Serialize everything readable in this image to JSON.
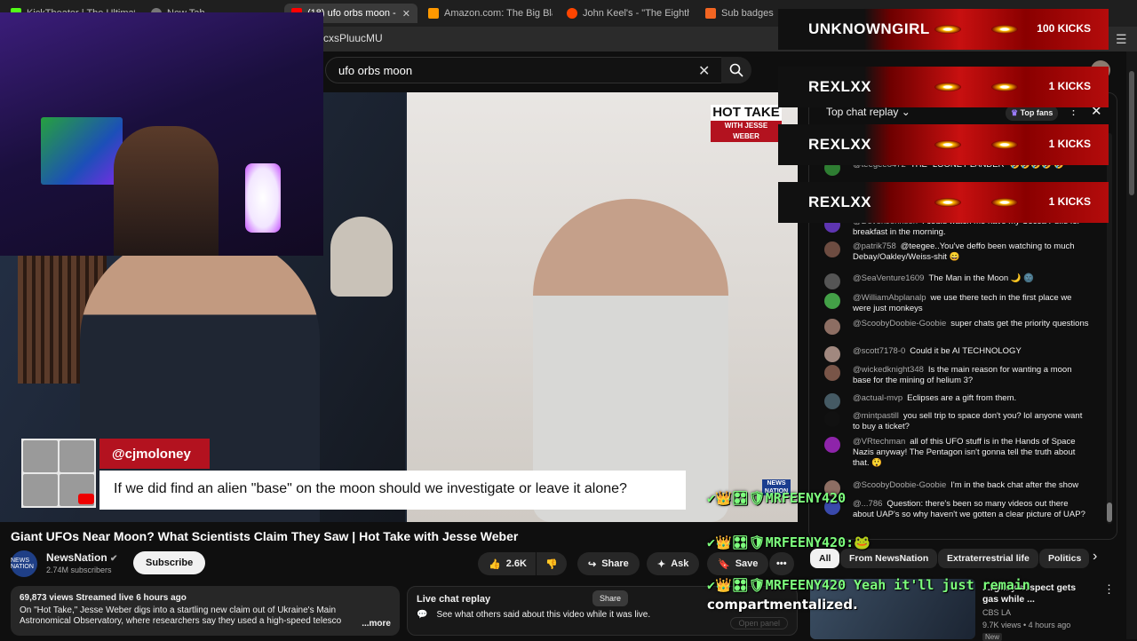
{
  "browser": {
    "tabs": [
      {
        "label": "KickTheater | The Ultimate Ki",
        "color": "#53fc18"
      },
      {
        "label": "New Tab",
        "color": "#888888"
      },
      {
        "label": "(18) ufo orbs moon -",
        "color": "#ff0000"
      },
      {
        "label": "Amazon.com: The Big Blacko",
        "color": "#ff9900"
      },
      {
        "label": "John Keel's - \"The Eighth Tow",
        "color": "#ff4500"
      },
      {
        "label": "Sub badges - El",
        "color": "#f26522"
      }
    ],
    "url_fragment": "cxsPluucMU"
  },
  "search": {
    "query": "ufo orbs moon"
  },
  "video": {
    "hot_take": "HOT TAKE",
    "hot_take_sub": "WITH JESSE WEBER",
    "handle": "@cjmoloney",
    "question": "If we did find an alien \"base\" on the moon should we investigate or leave it alone?",
    "news_logo": "NEWS NATION",
    "title": "Giant UFOs Near Moon? What Scientists Claim They Saw | Hot Take with Jesse Weber",
    "channel": "NewsNation",
    "channel_logo": "NEWS NATION",
    "subscribers": "2.74M subscribers",
    "subscribe_label": "Subscribe",
    "likes": "2.6K",
    "share_label": "Share",
    "ask_label": "Ask",
    "save_label": "Save"
  },
  "description": {
    "meta": "69,873 views  Streamed live 6 hours ago",
    "text": "On \"Hot Take,\" Jesse Weber digs into a startling new claim out of Ukraine's Main Astronomical Observatory, where researchers say they used a high-speed telesco",
    "more": "...more"
  },
  "live_replay": {
    "title": "Live chat replay",
    "share": "Share",
    "body": "See what others said about this video while it was live.",
    "open_panel": "Open panel"
  },
  "chat": {
    "header": "Top chat replay",
    "top_fans": "Top fans",
    "messages": [
      {
        "author": "@teegee8472",
        "text": "THE \"LOONEY LANDER\" 🤣🤣🤣🤣 🤣",
        "color": "#2e7d32"
      },
      {
        "author": "@DevenJohnson",
        "text": "I could watch me have my Cocoa Puffs for breakfast in the morning.",
        "color": "#5e35b1"
      },
      {
        "author": "@patrik758",
        "text": "@teegee..You've deffo been watching to much Debay/Oakley/Weiss-shit 😄",
        "color": "#6d4c41"
      },
      {
        "author": "@SeaVenture1609",
        "text": "The Man in the Moon 🌙 🌚",
        "color": "#555555"
      },
      {
        "author": "@WilliamAbplanalp",
        "text": "we use there tech in the first place we were just monkeys",
        "color": "#43a047"
      },
      {
        "author": "@ScoobyDoobie-Goobie",
        "text": "super chats get the priority questions",
        "color": "#8d6e63"
      },
      {
        "author": "@scott7178-0",
        "text": "Could it be AI TECHNOLOGY",
        "color": "#a1887f"
      },
      {
        "author": "@wickedknight348",
        "text": "Is the main reason for wanting a moon base for the mining of helium 3?",
        "color": "#795548"
      },
      {
        "author": "@actual-mvp",
        "text": "Eclipses are a gift from them.",
        "color": "#455a64"
      },
      {
        "author": "@mintpastill",
        "text": "you sell trip to space don't you? lol anyone want to buy a ticket?",
        "color": "#111111"
      },
      {
        "author": "@VRtechman",
        "text": "all of this UFO stuff is in the Hands of Space Nazis anyway! The Pentagon isn't gonna tell the truth about that. 😲",
        "color": "#8e24aa"
      },
      {
        "author": "@ScoobyDoobie-Goobie",
        "text": "I'm in the back chat after the show",
        "color": "#8d6e63"
      },
      {
        "author": "@...786",
        "text": "Question: there's been so many videos out there about UAP's so why haven't we gotten a clear picture of UAP?",
        "color": "#3949ab"
      }
    ]
  },
  "kicks": [
    {
      "name": "UNKNOWNGIRL",
      "amount": "100 KICKS"
    },
    {
      "name": "REXLXX",
      "amount": "1 KICKS"
    },
    {
      "name": "REXLXX",
      "amount": "1 KICKS"
    },
    {
      "name": "REXLXX",
      "amount": "1 KICKS"
    }
  ],
  "chips": [
    "All",
    "From NewsNation",
    "Extraterrestrial life",
    "Politics"
  ],
  "recommendation": {
    "title": "...rglary suspect gets gas while ...",
    "channel": "CBS LA",
    "meta": "9.7K views • 4 hours ago",
    "badge": "New"
  },
  "overlay": {
    "lines": [
      {
        "user": "MRFEENY420",
        "message": ""
      },
      {
        "user": "MRFEENY420:",
        "message": ""
      },
      {
        "user": "MRFEENY420",
        "message": "Yeah it'll just remain compartmentalized."
      }
    ],
    "compartmentalized_line1": "Yeah it'll just remain",
    "compartmentalized_line2": "compartmentalized."
  }
}
